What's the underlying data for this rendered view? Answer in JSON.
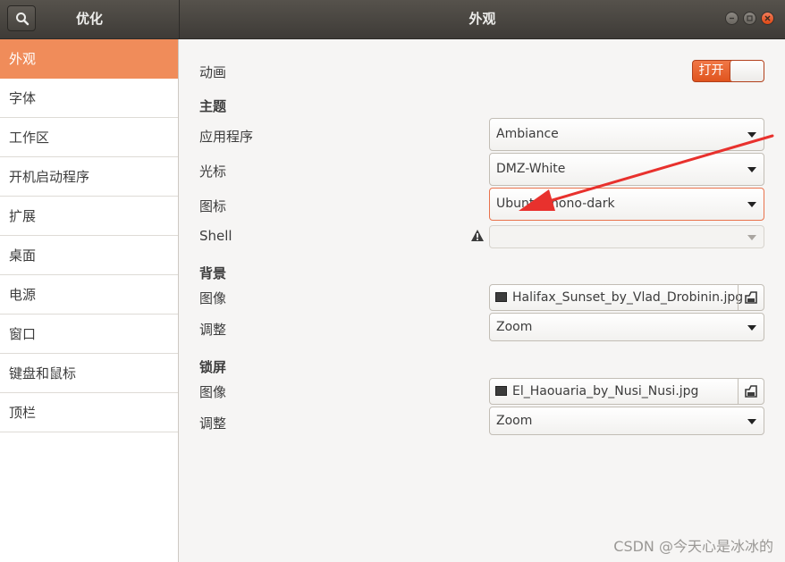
{
  "window": {
    "left_title": "优化",
    "main_title": "外观"
  },
  "sidebar": {
    "items": [
      {
        "label": "外观",
        "active": true
      },
      {
        "label": "字体"
      },
      {
        "label": "工作区"
      },
      {
        "label": "开机启动程序"
      },
      {
        "label": "扩展"
      },
      {
        "label": "桌面"
      },
      {
        "label": "电源"
      },
      {
        "label": "窗口"
      },
      {
        "label": "键盘和鼠标"
      },
      {
        "label": "顶栏"
      }
    ]
  },
  "appearance": {
    "animation_label": "动画",
    "animation_switch": "打开",
    "themes_header": "主题",
    "applications_label": "应用程序",
    "applications_value": "Ambiance",
    "cursor_label": "光标",
    "cursor_value": "DMZ-White",
    "icons_label": "图标",
    "icons_value": "Ubuntu-mono-dark",
    "shell_label": "Shell",
    "shell_value": "",
    "background_header": "背景",
    "bg_image_label": "图像",
    "bg_image_file": "Halifax_Sunset_by_Vlad_Drobinin.jpg",
    "bg_adjust_label": "调整",
    "bg_adjust_value": "Zoom",
    "lock_header": "锁屏",
    "lock_image_label": "图像",
    "lock_image_file": "El_Haouaria_by_Nusi_Nusi.jpg",
    "lock_adjust_label": "调整",
    "lock_adjust_value": "Zoom"
  },
  "watermark": "CSDN @今天心是冰冰的",
  "colors": {
    "accent": "#f08c5a",
    "switch_on": "#e95420",
    "annotation_arrow": "#e8312d"
  }
}
